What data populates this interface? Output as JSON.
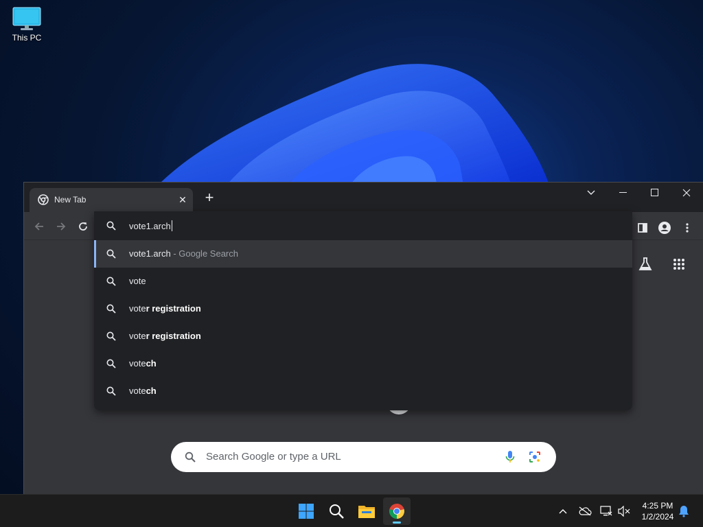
{
  "desktop": {
    "icon_label": "This PC"
  },
  "browser": {
    "tab_title": "New Tab",
    "omnibox": {
      "value": "vote1.arch",
      "suggestions": [
        {
          "prefix": "vote1.arch",
          "bold": "",
          "meta": " - Google Search",
          "selected": true
        },
        {
          "prefix": "vote",
          "bold": "",
          "meta": "",
          "selected": false
        },
        {
          "prefix": "vote",
          "bold": "r registration",
          "meta": "",
          "selected": false
        },
        {
          "prefix": "vote",
          "bold": "r registration",
          "meta": "",
          "selected": false
        },
        {
          "prefix": "vote",
          "bold": "ch",
          "meta": "",
          "selected": false
        },
        {
          "prefix": "vote",
          "bold": "ch",
          "meta": "",
          "selected": false
        }
      ]
    },
    "ntp_search_placeholder": "Search Google or type a URL"
  },
  "taskbar": {
    "time": "4:25 PM",
    "date": "1/2/2024"
  },
  "colors": {
    "accent": "#60cdff",
    "omnibox_bg": "#202124",
    "window_bg": "#35363a"
  }
}
